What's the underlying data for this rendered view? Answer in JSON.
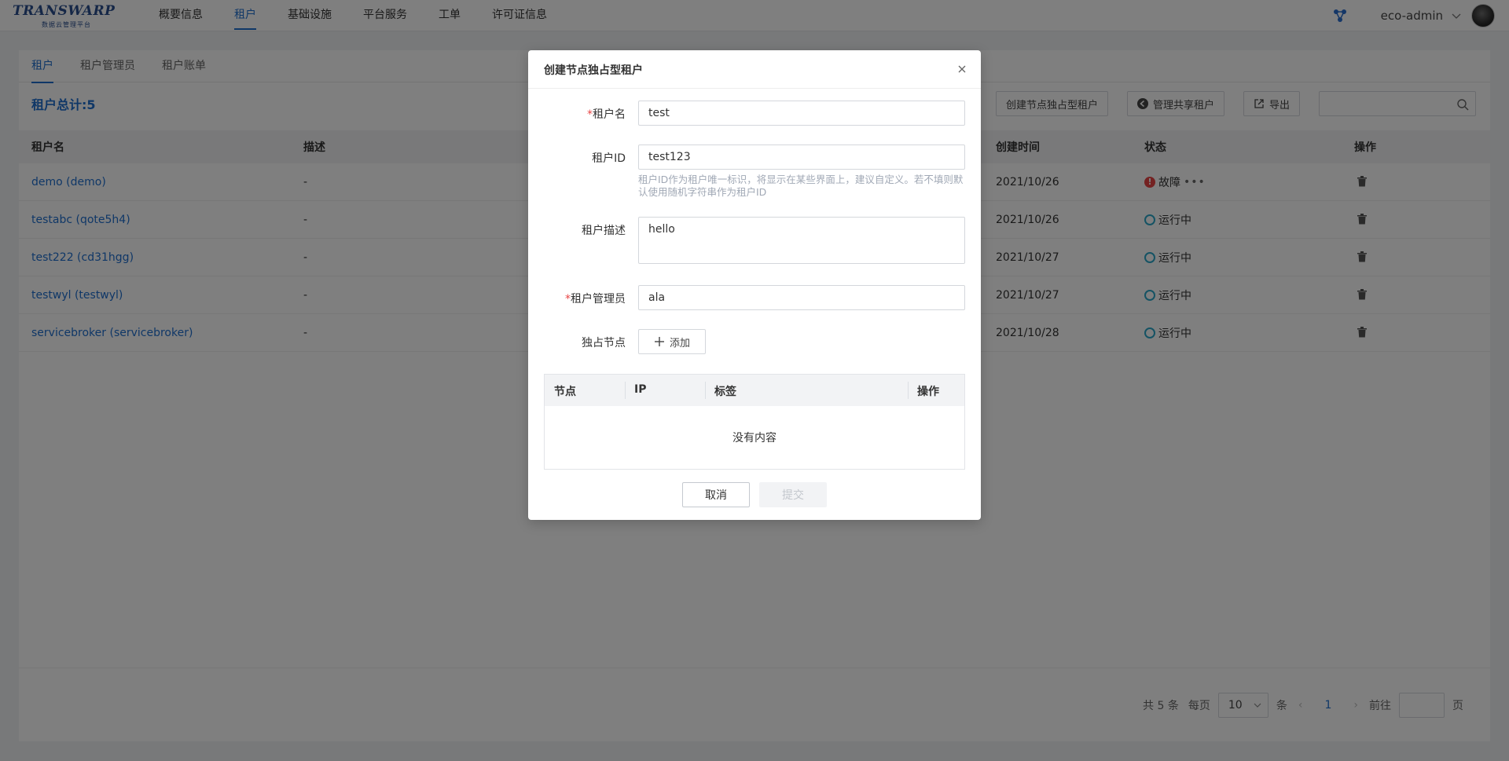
{
  "app": {
    "brand": "TRANSWARP",
    "brand_sub": "数据云管理平台"
  },
  "nav": {
    "items": [
      {
        "label": "概要信息"
      },
      {
        "label": "租户"
      },
      {
        "label": "基础设施"
      },
      {
        "label": "平台服务"
      },
      {
        "label": "工单"
      },
      {
        "label": "许可证信息"
      }
    ],
    "active_index": 1
  },
  "user": {
    "name": "eco-admin"
  },
  "page": {
    "tabs": [
      {
        "label": "租户"
      },
      {
        "label": "租户管理员"
      },
      {
        "label": "租户账单"
      }
    ],
    "summary": "租户总计:5",
    "toolbar": {
      "create_exclusive": "创建节点独占型租户",
      "manage_shared": "管理共享租户",
      "export": "导出"
    },
    "table": {
      "headers": {
        "name": "租户名",
        "desc": "描述",
        "created": "创建时间",
        "status": "状态",
        "actions": "操作"
      },
      "rows": [
        {
          "name": "demo (demo)",
          "desc": "-",
          "created": "2021/10/26",
          "status": "故障",
          "status_type": "error"
        },
        {
          "name": "testabc (qote5h4)",
          "desc": "-",
          "created": "2021/10/26",
          "status": "运行中",
          "status_type": "running"
        },
        {
          "name": "test222 (cd31hgg)",
          "desc": "-",
          "created": "2021/10/27",
          "status": "运行中",
          "status_type": "running"
        },
        {
          "name": "testwyl (testwyl)",
          "desc": "-",
          "created": "2021/10/27",
          "status": "运行中",
          "status_type": "running"
        },
        {
          "name": "servicebroker (servicebroker)",
          "desc": "-",
          "created": "2021/10/28",
          "status": "运行中",
          "status_type": "running"
        }
      ]
    },
    "pager": {
      "total": "共 5 条",
      "per_page_label": "每页",
      "per_page": "10",
      "unit": "条",
      "current_page": "1",
      "goto_label": "前往",
      "page_unit": "页"
    }
  },
  "modal": {
    "title": "创建节点独占型租户",
    "fields": {
      "tenant_name": {
        "label": "租户名",
        "value": "test"
      },
      "tenant_id": {
        "label": "租户ID",
        "value": "test123",
        "hint": "租户ID作为租户唯一标识，将显示在某些界面上，建议自定义。若不填则默认使用随机字符串作为租户ID"
      },
      "tenant_desc": {
        "label": "租户描述",
        "value": "hello"
      },
      "tenant_admin": {
        "label": "租户管理员",
        "value": "ala"
      },
      "exclusive_nodes": {
        "label": "独占节点",
        "add_label": "添加"
      }
    },
    "required_mark": "*",
    "node_table": {
      "headers": [
        "节点",
        "IP",
        "标签",
        "操作"
      ],
      "empty_text": "没有内容"
    },
    "cancel_label": "取消",
    "submit_label": "提交"
  },
  "colors": {
    "accent": "#1f6fcf",
    "error": "#e84545",
    "running": "#2aa7c8"
  }
}
